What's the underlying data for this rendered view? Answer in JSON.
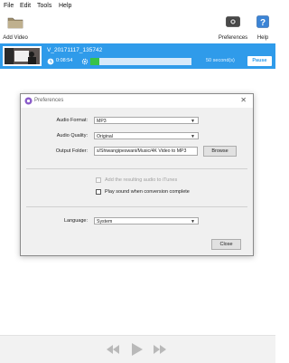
{
  "menubar": {
    "items": [
      "File",
      "Edit",
      "Tools",
      "Help"
    ]
  },
  "toolbar": {
    "add_video_label": "Add Video",
    "preferences_label": "Preferences",
    "help_label": "Help"
  },
  "download": {
    "title": "V_20171117_135742",
    "elapsed": "0:08:54",
    "progress_fraction": 0.09,
    "seconds": "50 second(s)",
    "pause_label": "Pause"
  },
  "preferences": {
    "title": "Preferences",
    "close_glyph": "✕",
    "audio_format_label": "Audio Format:",
    "audio_format_value": "MP3",
    "audio_quality_label": "Audio Quality:",
    "audio_quality_value": "Original",
    "output_folder_label": "Output Folder:",
    "output_folder_value": "s/Shiwangipeswani/Music/4K Video to MP3",
    "browse_label": "Browse",
    "itunes_label": "Add the resulting audio to iTunes",
    "play_sound_label": "Play sound when conversion complete",
    "language_label": "Language:",
    "language_value": "System",
    "close_button_label": "Close"
  },
  "colors": {
    "accent": "#2f9bea",
    "progress": "#37c24a"
  }
}
